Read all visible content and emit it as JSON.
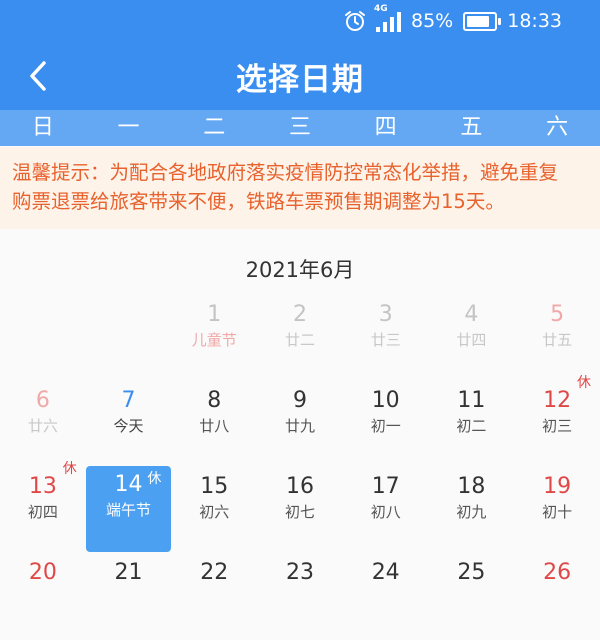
{
  "status_bar": {
    "network": "4G",
    "battery": "85%",
    "battery_level": 0.85,
    "time": "18:33"
  },
  "header": {
    "title": "选择日期"
  },
  "weekdays": [
    "日",
    "一",
    "二",
    "三",
    "四",
    "五",
    "六"
  ],
  "notice": {
    "line1": "温馨提示：为配合各地政府落实疫情防控常态化举措，避免重复",
    "line2": "购票退票给旅客带来不便，铁路车票预售期调整为15天。"
  },
  "calendar": {
    "month_title": "2021年6月",
    "selected_day": "14",
    "days": [
      {
        "day": "1",
        "sub": "儿童节",
        "state": "past-holiday",
        "badge": ""
      },
      {
        "day": "2",
        "sub": "廿二",
        "state": "past",
        "badge": ""
      },
      {
        "day": "3",
        "sub": "廿三",
        "state": "past",
        "badge": ""
      },
      {
        "day": "4",
        "sub": "廿四",
        "state": "past",
        "badge": ""
      },
      {
        "day": "5",
        "sub": "廿五",
        "state": "past-weekend",
        "badge": ""
      },
      {
        "day": "6",
        "sub": "廿六",
        "state": "past-weekend",
        "badge": ""
      },
      {
        "day": "7",
        "sub": "今天",
        "state": "today",
        "badge": ""
      },
      {
        "day": "8",
        "sub": "廿八",
        "state": "normal",
        "badge": ""
      },
      {
        "day": "9",
        "sub": "廿九",
        "state": "normal",
        "badge": ""
      },
      {
        "day": "10",
        "sub": "初一",
        "state": "normal",
        "badge": ""
      },
      {
        "day": "11",
        "sub": "初二",
        "state": "normal",
        "badge": ""
      },
      {
        "day": "12",
        "sub": "初三",
        "state": "weekend",
        "badge": "休"
      },
      {
        "day": "13",
        "sub": "初四",
        "state": "weekend",
        "badge": "休"
      },
      {
        "day": "14",
        "sub": "端午节",
        "state": "selected",
        "badge": "休"
      },
      {
        "day": "15",
        "sub": "初六",
        "state": "normal",
        "badge": ""
      },
      {
        "day": "16",
        "sub": "初七",
        "state": "normal",
        "badge": ""
      },
      {
        "day": "17",
        "sub": "初八",
        "state": "normal",
        "badge": ""
      },
      {
        "day": "18",
        "sub": "初九",
        "state": "normal",
        "badge": ""
      },
      {
        "day": "19",
        "sub": "初十",
        "state": "weekend",
        "badge": ""
      },
      {
        "day": "20",
        "sub": "",
        "state": "weekend",
        "badge": ""
      },
      {
        "day": "21",
        "sub": "",
        "state": "normal",
        "badge": ""
      },
      {
        "day": "22",
        "sub": "",
        "state": "normal",
        "badge": ""
      },
      {
        "day": "23",
        "sub": "",
        "state": "normal",
        "badge": ""
      },
      {
        "day": "24",
        "sub": "",
        "state": "normal",
        "badge": ""
      },
      {
        "day": "25",
        "sub": "",
        "state": "normal",
        "badge": ""
      },
      {
        "day": "26",
        "sub": "",
        "state": "weekend",
        "badge": ""
      }
    ]
  },
  "colors": {
    "accent": "#3a8ef0",
    "weekday_bar": "#64a8f4",
    "notice_bg": "#fdf3e8",
    "notice_text": "#e8622e",
    "weekend": "#e04848"
  }
}
